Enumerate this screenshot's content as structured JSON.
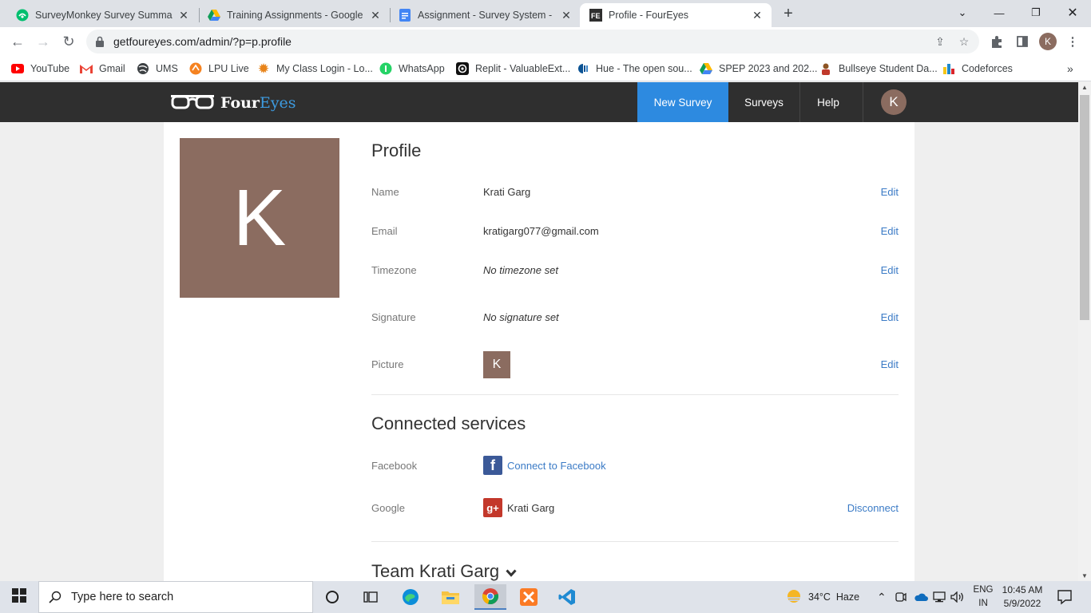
{
  "browser": {
    "tabs": [
      {
        "title": "SurveyMonkey Survey Summary",
        "icon": "surveymonkey-icon"
      },
      {
        "title": "Training Assignments - Google D",
        "icon": "google-drive-icon"
      },
      {
        "title": "Assignment - Survey System - Go",
        "icon": "google-docs-icon"
      },
      {
        "title": "Profile - FourEyes",
        "icon": "foureyes-icon",
        "active": true
      }
    ],
    "url": "getfoureyes.com/admin/?p=p.profile",
    "profile_initial": "K",
    "bookmarks": [
      {
        "label": "YouTube",
        "icon": "youtube-icon"
      },
      {
        "label": "Gmail",
        "icon": "gmail-icon"
      },
      {
        "label": "UMS",
        "icon": "globe-icon"
      },
      {
        "label": "LPU Live",
        "icon": "lpu-live-icon"
      },
      {
        "label": "My Class Login - Lo...",
        "icon": "sun-icon"
      },
      {
        "label": "WhatsApp",
        "icon": "whatsapp-icon"
      },
      {
        "label": "Replit - ValuableExt...",
        "icon": "replit-icon"
      },
      {
        "label": "Hue - The open sou...",
        "icon": "hue-icon"
      },
      {
        "label": "SPEP 2023 and 202...",
        "icon": "google-drive-icon"
      },
      {
        "label": "Bullseye Student Da...",
        "icon": "bullseye-icon"
      },
      {
        "label": "Codeforces",
        "icon": "codeforces-icon"
      }
    ]
  },
  "site": {
    "brand_first": "Four",
    "brand_second": "Eyes",
    "nav": {
      "new_survey": "New Survey",
      "surveys": "Surveys",
      "help": "Help"
    },
    "user_initial": "K",
    "accent_color": "#2d8ae0"
  },
  "profile": {
    "heading": "Profile",
    "avatar_initial": "K",
    "rows": {
      "name": {
        "label": "Name",
        "value": "Krati Garg"
      },
      "email": {
        "label": "Email",
        "value": "kratigarg077@gmail.com"
      },
      "timezone": {
        "label": "Timezone",
        "value": "No timezone set"
      },
      "signature": {
        "label": "Signature",
        "value": "No signature set"
      },
      "picture": {
        "label": "Picture",
        "value": "K"
      }
    },
    "edit_label": "Edit"
  },
  "connected_services": {
    "heading": "Connected services",
    "facebook": {
      "label": "Facebook",
      "action": "Connect to Facebook"
    },
    "google": {
      "label": "Google",
      "account": "Krati Garg",
      "action": "Disconnect"
    }
  },
  "team": {
    "heading": "Team Krati Garg"
  },
  "taskbar": {
    "search_placeholder": "Type here to search",
    "weather": "34°C  Haze",
    "lang_line1": "ENG",
    "lang_line2": "IN",
    "time": "10:45 AM",
    "date": "5/9/2022"
  }
}
